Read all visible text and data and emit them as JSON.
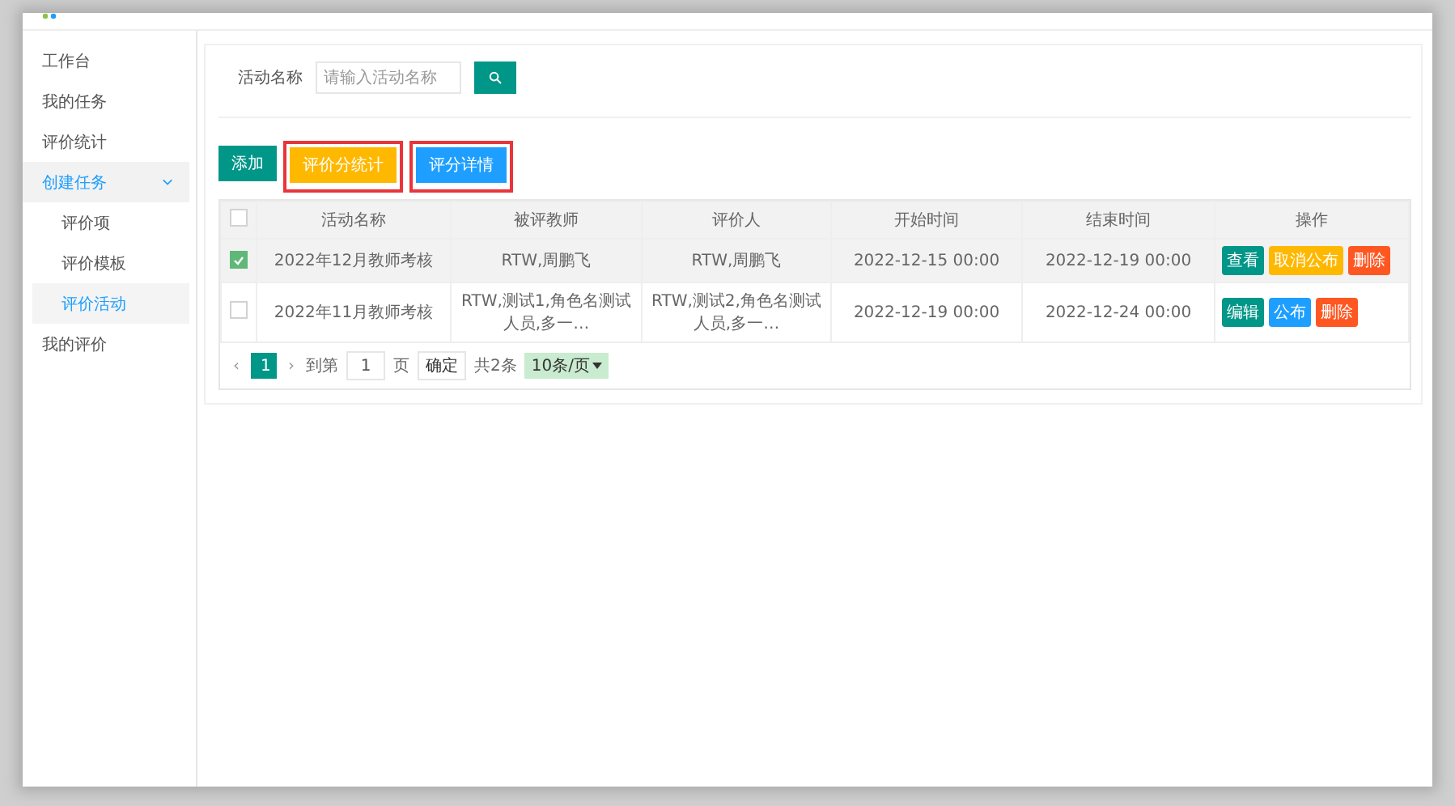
{
  "sidebar": {
    "items": [
      {
        "label": "工作台",
        "selected": false
      },
      {
        "label": "我的任务",
        "selected": false
      },
      {
        "label": "评价统计",
        "selected": false
      },
      {
        "label": "创建任务",
        "selected": true,
        "expanded": true,
        "children": [
          {
            "label": "评价项",
            "selected": false
          },
          {
            "label": "评价模板",
            "selected": false
          },
          {
            "label": "评价活动",
            "selected": true
          }
        ]
      },
      {
        "label": "我的评价",
        "selected": false
      }
    ]
  },
  "search": {
    "label": "活动名称",
    "placeholder": "请输入活动名称"
  },
  "toolbar": [
    {
      "label": "添加",
      "color": "#009688",
      "highlighted": false
    },
    {
      "label": "评价分统计",
      "color": "#ffb800",
      "highlighted": true
    },
    {
      "label": "评分详情",
      "color": "#1e9fff",
      "highlighted": true
    }
  ],
  "table": {
    "columns": [
      "活动名称",
      "被评教师",
      "评价人",
      "开始时间",
      "结束时间",
      "操作"
    ],
    "header_checked": false,
    "rows": [
      {
        "checked": true,
        "cells": [
          "2022年12月教师考核",
          "RTW,周鹏飞",
          "RTW,周鹏飞",
          "2022-12-15 00:00",
          "2022-12-19 00:00"
        ],
        "actions": [
          {
            "label": "查看",
            "color": "#009688"
          },
          {
            "label": "取消公布",
            "color": "#ffb800"
          },
          {
            "label": "删除",
            "color": "#ff5722"
          }
        ]
      },
      {
        "checked": false,
        "cells": [
          "2022年11月教师考核",
          "RTW,测试1,角色名测试人员,多一…",
          "RTW,测试2,角色名测试人员,多一…",
          "2022-12-19 00:00",
          "2022-12-24 00:00"
        ],
        "actions": [
          {
            "label": "编辑",
            "color": "#009688"
          },
          {
            "label": "公布",
            "color": "#1e9fff"
          },
          {
            "label": "删除",
            "color": "#ff5722"
          }
        ]
      }
    ]
  },
  "pager": {
    "prev": "‹",
    "pages": [
      {
        "label": "1",
        "selected": true
      }
    ],
    "next": "›",
    "goto_label": "到第",
    "goto_value": "1",
    "page_unit": "页",
    "confirm": "确定",
    "total": "共2条",
    "page_size": "10条/页"
  }
}
